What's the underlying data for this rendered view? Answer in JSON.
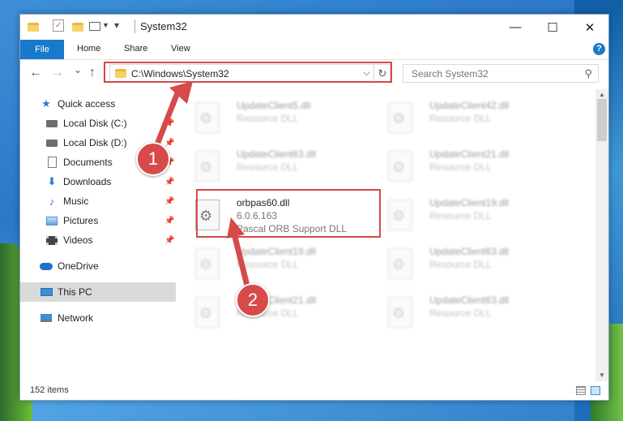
{
  "window": {
    "title": "System32",
    "minimize_glyph": "—",
    "maximize_glyph": "☐",
    "close_glyph": "✕"
  },
  "ribbon": {
    "file_label": "File",
    "tabs": [
      "Home",
      "Share",
      "View"
    ],
    "help_glyph": "?"
  },
  "nav": {
    "back_glyph": "←",
    "forward_glyph": "→",
    "recent_glyph": "⌄",
    "up_glyph": "↑",
    "address": "C:\\Windows\\System32",
    "address_dropdown_glyph": "⌵",
    "refresh_glyph": "↻",
    "search_placeholder": "Search System32",
    "search_glyph": "⚲"
  },
  "sidebar": {
    "items": [
      {
        "label": "Quick access",
        "icon": "star-icon"
      },
      {
        "label": "Local Disk (C:)",
        "icon": "drive-icon"
      },
      {
        "label": "Local Disk (D:)",
        "icon": "drive-icon"
      },
      {
        "label": "Documents",
        "icon": "documents-icon"
      },
      {
        "label": "Downloads",
        "icon": "downloads-icon"
      },
      {
        "label": "Music",
        "icon": "music-icon"
      },
      {
        "label": "Pictures",
        "icon": "pictures-icon"
      },
      {
        "label": "Videos",
        "icon": "videos-icon"
      },
      {
        "label": "OneDrive",
        "icon": "onedrive-icon"
      },
      {
        "label": "This PC",
        "icon": "pc-icon"
      },
      {
        "label": "Network",
        "icon": "network-icon"
      }
    ],
    "pin_glyph": "📌"
  },
  "files": {
    "highlighted": {
      "name": "orbpas60.dll",
      "version": "6.0.6.163",
      "description": "Pascal ORB Support DLL"
    },
    "blurred": [
      {
        "name": "UpdateClient5.dll",
        "desc": "Resource DLL"
      },
      {
        "name": "UpdateClient42.dll",
        "desc": "Resource DLL"
      },
      {
        "name": "UpdateClient63.dll",
        "desc": "Resource DLL"
      },
      {
        "name": "UpdateClient21.dll",
        "desc": "Resource DLL"
      },
      {
        "name": "UpdateClient19.dll",
        "desc": "Resource DLL"
      },
      {
        "name": "UpdateClient19.dll",
        "desc": "Resource DLL"
      },
      {
        "name": "UpdateClient63.dll",
        "desc": "Resource DLL"
      },
      {
        "name": "UpdateClient21.dll",
        "desc": "Resource DLL"
      },
      {
        "name": "UpdateClient63.dll",
        "desc": "Resource DLL"
      }
    ]
  },
  "status": {
    "item_count": "152 items"
  },
  "annotations": {
    "step1": "1",
    "step2": "2",
    "accent_color": "#d24a4a"
  }
}
